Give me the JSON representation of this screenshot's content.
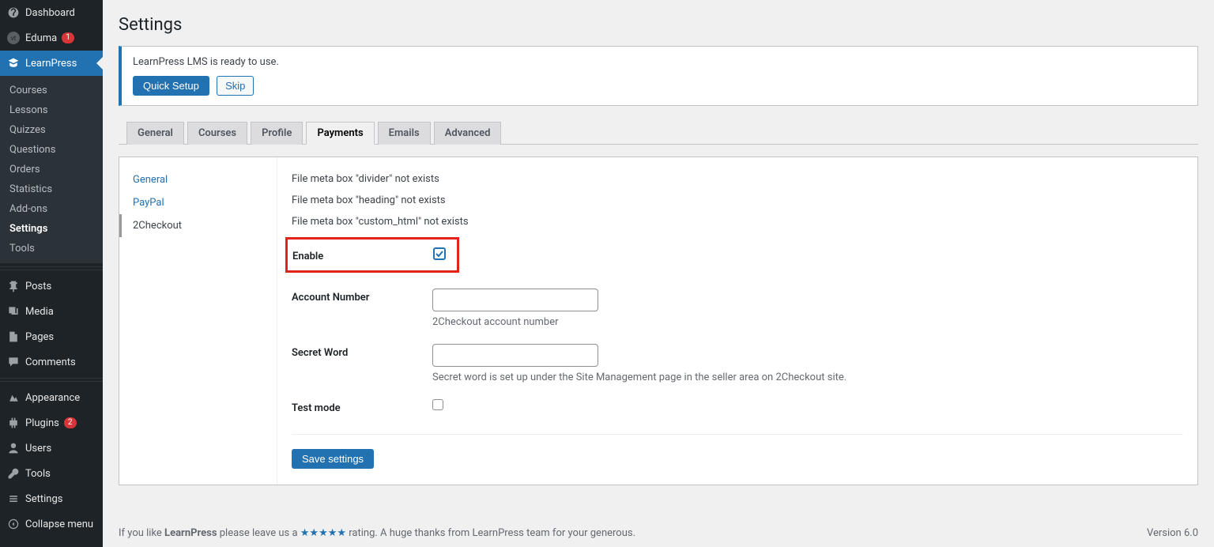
{
  "page": {
    "title": "Settings"
  },
  "sidebar": {
    "dashboard": "Dashboard",
    "eduma": "Eduma",
    "eduma_badge": "1",
    "learnpress": "LearnPress",
    "sub": {
      "courses": "Courses",
      "lessons": "Lessons",
      "quizzes": "Quizzes",
      "questions": "Questions",
      "orders": "Orders",
      "statistics": "Statistics",
      "addons": "Add-ons",
      "settings": "Settings",
      "tools": "Tools"
    },
    "posts": "Posts",
    "media": "Media",
    "pages": "Pages",
    "comments": "Comments",
    "appearance": "Appearance",
    "plugins": "Plugins",
    "plugins_badge": "2",
    "users": "Users",
    "tools": "Tools",
    "settings": "Settings",
    "collapse": "Collapse menu"
  },
  "notice": {
    "message": "LearnPress LMS is ready to use.",
    "quick_setup": "Quick Setup",
    "skip": "Skip"
  },
  "tabs": {
    "general": "General",
    "courses": "Courses",
    "profile": "Profile",
    "payments": "Payments",
    "emails": "Emails",
    "advanced": "Advanced"
  },
  "payments_sub": {
    "general": "General",
    "paypal": "PayPal",
    "twocheckout": "2Checkout"
  },
  "meta": {
    "m1": "File meta box \"divider\" not exists",
    "m2": "File meta box \"heading\" not exists",
    "m3": "File meta box \"custom_html\" not exists"
  },
  "form": {
    "enable_label": "Enable",
    "account_label": "Account Number",
    "account_desc": "2Checkout account number",
    "secret_label": "Secret Word",
    "secret_desc": "Secret word is set up under the Site Management page in the seller area on 2Checkout site.",
    "test_label": "Test mode",
    "save": "Save settings"
  },
  "footer": {
    "text_a": "If you like ",
    "text_b": "LearnPress",
    "text_c": " please leave us a ",
    "stars": "★★★★★",
    "text_d": " rating. A huge thanks from LearnPress team for your generous.",
    "version": "Version 6.0"
  }
}
